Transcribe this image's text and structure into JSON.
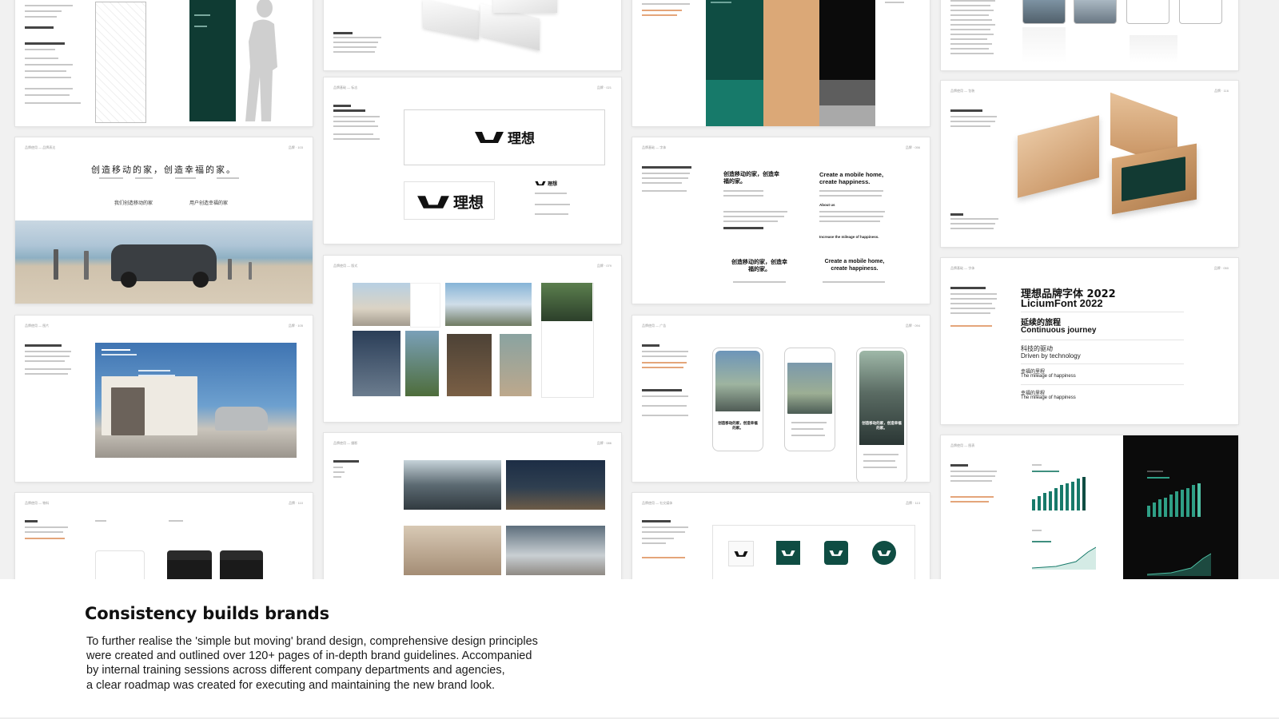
{
  "caption": {
    "headline": "Consistency builds brands",
    "body_lines": [
      "To further realise the 'simple but moving' brand design, comprehensive design principles",
      "were created and outlined over 120+ pages of in-depth brand guidelines. Accompanied",
      "by internal training sessions across different company departments and agencies,",
      "a clear roadmap was created for executing and maintaining the new brand look."
    ]
  },
  "pages": {
    "slogan_page": {
      "slogan": "创造移动的家，创造幸福的家。",
      "left_sub": "我们创造移动的家",
      "right_sub": "用户创造幸福的家"
    },
    "logo_page": {
      "wordmark": "理想",
      "small_wordmark": "理想"
    },
    "font_page": {
      "font_title_cn": "理想品牌字体 2022",
      "font_title_en": "LiciumFont 2022",
      "journey_cn": "延续的旅程",
      "journey_en": "Continuous journey",
      "tech_cn": "科技的驱动",
      "tech_en": "Driven by technology",
      "happy_cn_1": "幸福的里程",
      "happy_en_1": "The mileage of happiness",
      "happy_cn_2": "幸福的里程",
      "happy_en_2": "The mileage of happiness"
    },
    "type_layout_page": {
      "cn_headline": "创造移动的家，创造幸福的家。",
      "en_headline_1": "Create a mobile home,",
      "en_headline_2": "create happiness.",
      "cn_headline_b": "创造移动的家，创造幸福的家。",
      "en_headline_b_1": "Create a mobile home,",
      "en_headline_b_2": "create happiness.",
      "about_label": "About us",
      "mileage_line": "Increase the mileage of happiness."
    },
    "mobile_ad_page": {
      "phone_headline_1": "创造移动的家，创造幸福的家。",
      "phone_headline_2": "创造移动的家，创造幸福的家。"
    }
  },
  "colors": {
    "brand_green": "#0f4d43",
    "brand_teal": "#177a6a",
    "brand_tan": "#dba877",
    "brand_black": "#0b0b0b",
    "accent_orange": "#e4a57a"
  }
}
